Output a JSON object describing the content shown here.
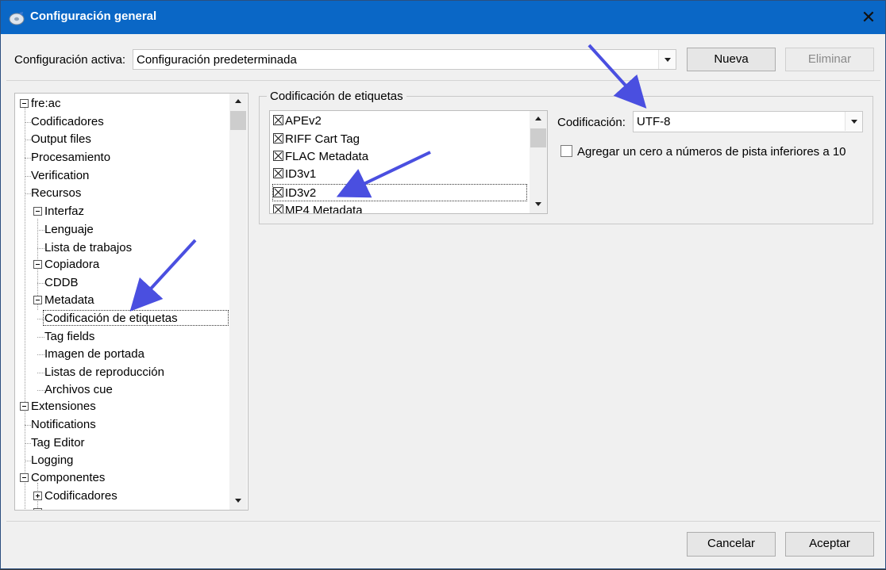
{
  "window": {
    "title": "Configuración general",
    "close_glyph": "✕"
  },
  "config": {
    "label": "Configuración activa:",
    "selected": "Configuración predeterminada",
    "new_button": "Nueva",
    "delete_button": "Eliminar"
  },
  "tree": {
    "items": [
      {
        "label": "fre:ac"
      },
      {
        "label": "Codificadores"
      },
      {
        "label": "Output files"
      },
      {
        "label": "Procesamiento"
      },
      {
        "label": "Verification"
      },
      {
        "label": "Recursos"
      },
      {
        "label": "Interfaz"
      },
      {
        "label": "Lenguaje"
      },
      {
        "label": "Lista de trabajos"
      },
      {
        "label": "Copiadora"
      },
      {
        "label": "CDDB"
      },
      {
        "label": "Metadata"
      },
      {
        "label": "Codificación de etiquetas"
      },
      {
        "label": "Tag fields"
      },
      {
        "label": "Imagen de portada"
      },
      {
        "label": "Listas de reproducción"
      },
      {
        "label": "Archivos cue"
      },
      {
        "label": "Extensiones"
      },
      {
        "label": "Notifications"
      },
      {
        "label": "Tag Editor"
      },
      {
        "label": "Logging"
      },
      {
        "label": "Componentes"
      },
      {
        "label": "Codificadores"
      }
    ]
  },
  "tag_encoding": {
    "group_title": "Codificación de etiquetas",
    "formats": [
      {
        "label": "APEv2",
        "checked": true
      },
      {
        "label": "RIFF Cart Tag",
        "checked": true
      },
      {
        "label": "FLAC Metadata",
        "checked": true
      },
      {
        "label": "ID3v1",
        "checked": true
      },
      {
        "label": "ID3v2",
        "checked": true
      },
      {
        "label": "MP4 Metadata",
        "checked": true
      }
    ],
    "encoding_label": "Codificación:",
    "encoding_value": "UTF-8",
    "zero_pad_label": "Agregar un cero a números de pista inferiores a 10",
    "zero_pad_checked": false
  },
  "footer": {
    "cancel_button": "Cancelar",
    "accept_button": "Aceptar"
  },
  "colors": {
    "titlebar": "#0a67c6",
    "annotation_arrow": "#4a4fe0"
  }
}
